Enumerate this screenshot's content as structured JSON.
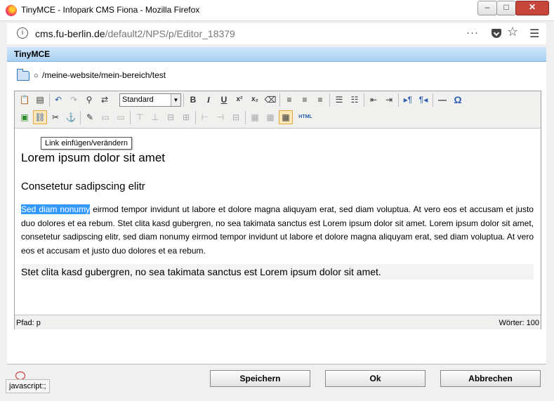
{
  "window": {
    "title": "TinyMCE - Infopark CMS Fiona - Mozilla Firefox"
  },
  "url": {
    "domain": "cms.fu-berlin.de",
    "path": "/default2/NPS/p/Editor_18379",
    "more": "···"
  },
  "header": {
    "title": "TinyMCE"
  },
  "path_row": {
    "bullet": "○",
    "path": "/meine-website/mein-bereich/test"
  },
  "toolbar": {
    "format_value": "Standard",
    "bold": "B",
    "italic": "I",
    "underline": "U",
    "superscript": "x²",
    "subscript": "x₂",
    "hr": "—",
    "omega": "Ω",
    "html": "HTML"
  },
  "tooltip": "Link einfügen/verändern",
  "content": {
    "h1": "Lorem ipsum dolor sit amet",
    "h2": "Consetetur sadipscing elitr",
    "para_selected": "Sed diam nonumy",
    "para_rest": " eirmod tempor invidunt ut labore et dolore magna aliquyam erat, sed diam voluptua. At vero eos et accusam et justo duo dolores et ea rebum. Stet clita kasd gubergren, no sea takimata sanctus est Lorem ipsum dolor sit amet. Lorem ipsum dolor sit amet, consetetur sadipscing elitr, sed diam nonumy eirmod tempor invidunt ut labore et dolore magna aliquyam erat, sed diam voluptua. At vero eos et accusam et justo duo dolores et ea rebum.",
    "para2": "Stet clita kasd gubergren, no sea takimata sanctus est Lorem ipsum dolor sit amet."
  },
  "status": {
    "path": "Pfad: p",
    "words": "Wörter: 100"
  },
  "buttons": {
    "save": "Speichern",
    "ok": "Ok",
    "cancel": "Abbrechen"
  },
  "statuspop": "javascript:;",
  "colors": {
    "header_blue": "#a9d0f2",
    "selection": "#3399ff",
    "active_button": "#fde7b4"
  }
}
